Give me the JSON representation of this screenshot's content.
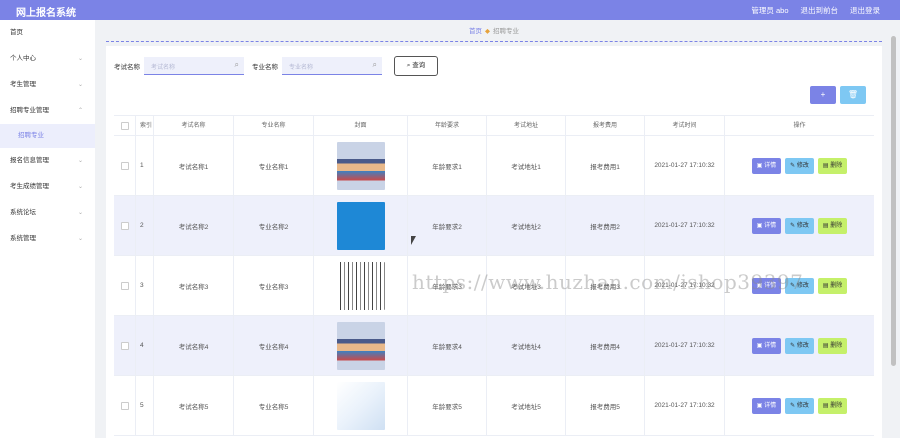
{
  "app": {
    "title": "网上报名系统",
    "user": "管理员 abo",
    "back_to_front": "退出到前台",
    "logout": "退出登录"
  },
  "sidebar": {
    "items": [
      {
        "label": "首页"
      },
      {
        "label": "个人中心"
      },
      {
        "label": "考生管理"
      },
      {
        "label": "招聘专业管理"
      },
      {
        "label": "报名信息管理"
      },
      {
        "label": "考生成绩管理"
      },
      {
        "label": "系统论坛"
      },
      {
        "label": "系统管理"
      }
    ],
    "sub_item": "招聘专业"
  },
  "breadcrumb": {
    "home": "首页",
    "current": "招聘专业"
  },
  "search": {
    "exam_label": "考试名称",
    "exam_placeholder": "考试名称",
    "major_label": "专业名称",
    "major_placeholder": "专业名称",
    "query_button": "查询"
  },
  "table": {
    "headers": [
      "索引",
      "考试名称",
      "专业名称",
      "封面",
      "年龄要求",
      "考试地址",
      "报考费用",
      "考试时间",
      "操作"
    ],
    "rows": [
      {
        "index": "1",
        "exam": "考试名称1",
        "major": "专业名称1",
        "age": "年龄要求1",
        "address": "考试地址1",
        "fee": "报考费用1",
        "time": "2021-01-27 17:10:32"
      },
      {
        "index": "2",
        "exam": "考试名称2",
        "major": "专业名称2",
        "age": "年龄要求2",
        "address": "考试地址2",
        "fee": "报考费用2",
        "time": "2021-01-27 17:10:32"
      },
      {
        "index": "3",
        "exam": "考试名称3",
        "major": "专业名称3",
        "age": "年龄要求3",
        "address": "考试地址3",
        "fee": "报考费用3",
        "time": "2021-01-27 17:10:32"
      },
      {
        "index": "4",
        "exam": "考试名称4",
        "major": "专业名称4",
        "age": "年龄要求4",
        "address": "考试地址4",
        "fee": "报考费用4",
        "time": "2021-01-27 17:10:32"
      },
      {
        "index": "5",
        "exam": "考试名称5",
        "major": "专业名称5",
        "age": "年龄要求5",
        "address": "考试地址5",
        "fee": "报考费用5",
        "time": "2021-01-27 17:10:32"
      }
    ],
    "actions": {
      "detail": "详情",
      "edit": "修改",
      "delete": "删除"
    }
  },
  "watermark": "https://www.huzhan.com/ishop39397",
  "colors": {
    "accent": "#7b83e6",
    "edit": "#7ec8f3",
    "delete": "#c5f06a"
  }
}
